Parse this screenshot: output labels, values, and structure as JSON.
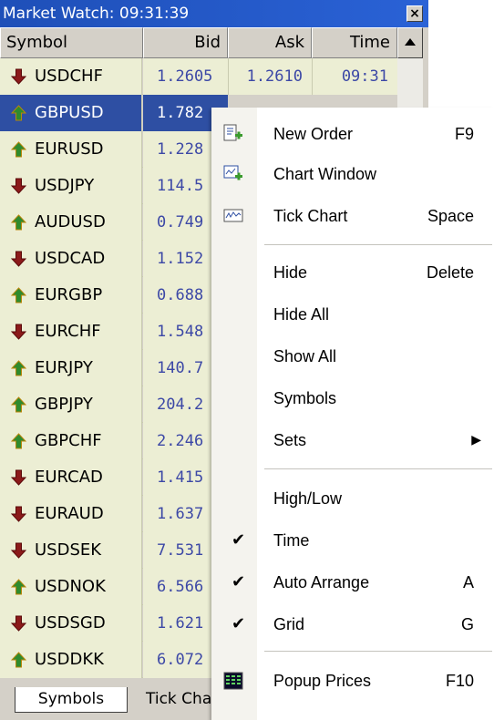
{
  "window": {
    "title": "Market Watch: 09:31:39",
    "close_glyph": "×"
  },
  "columns": {
    "symbol": "Symbol",
    "bid": "Bid",
    "ask": "Ask",
    "time": "Time"
  },
  "rows": [
    {
      "symbol": "USDCHF",
      "bid": "1.2605",
      "ask": "1.2610",
      "time": "09:31",
      "direction": "down"
    },
    {
      "symbol": "GBPUSD",
      "bid": "1.782",
      "direction": "up",
      "selected": true
    },
    {
      "symbol": "EURUSD",
      "bid": "1.228",
      "direction": "up"
    },
    {
      "symbol": "USDJPY",
      "bid": "114.5",
      "direction": "down"
    },
    {
      "symbol": "AUDUSD",
      "bid": "0.749",
      "direction": "up"
    },
    {
      "symbol": "USDCAD",
      "bid": "1.152",
      "direction": "down"
    },
    {
      "symbol": "EURGBP",
      "bid": "0.688",
      "direction": "up"
    },
    {
      "symbol": "EURCHF",
      "bid": "1.548",
      "direction": "down"
    },
    {
      "symbol": "EURJPY",
      "bid": "140.7",
      "direction": "up"
    },
    {
      "symbol": "GBPJPY",
      "bid": "204.2",
      "direction": "up"
    },
    {
      "symbol": "GBPCHF",
      "bid": "2.246",
      "direction": "up"
    },
    {
      "symbol": "EURCAD",
      "bid": "1.415",
      "direction": "down"
    },
    {
      "symbol": "EURAUD",
      "bid": "1.637",
      "direction": "down"
    },
    {
      "symbol": "USDSEK",
      "bid": "7.531",
      "direction": "down"
    },
    {
      "symbol": "USDNOK",
      "bid": "6.566",
      "direction": "up"
    },
    {
      "symbol": "USDSGD",
      "bid": "1.621",
      "direction": "down"
    },
    {
      "symbol": "USDDKK",
      "bid": "6.072",
      "direction": "up"
    }
  ],
  "tabs": {
    "symbols": "Symbols",
    "tick_chart": "Tick Chart"
  },
  "menu": {
    "new_order": {
      "label": "New Order",
      "shortcut": "F9",
      "icon": "new-order-icon"
    },
    "chart_window": {
      "label": "Chart Window",
      "icon": "chart-window-icon"
    },
    "tick_chart": {
      "label": "Tick Chart",
      "shortcut": "Space",
      "icon": "tick-chart-icon"
    },
    "hide": {
      "label": "Hide",
      "shortcut": "Delete"
    },
    "hide_all": {
      "label": "Hide All"
    },
    "show_all": {
      "label": "Show All"
    },
    "symbols": {
      "label": "Symbols"
    },
    "sets": {
      "label": "Sets",
      "submenu_glyph": "▶"
    },
    "high_low": {
      "label": "High/Low",
      "checked": false
    },
    "time": {
      "label": "Time",
      "checked": true
    },
    "auto_arrange": {
      "label": "Auto Arrange",
      "shortcut": "A",
      "checked": true
    },
    "grid": {
      "label": "Grid",
      "shortcut": "G",
      "checked": true
    },
    "popup_prices": {
      "label": "Popup Prices",
      "shortcut": "F10",
      "icon": "popup-prices-icon"
    },
    "check_glyph": "✔"
  },
  "colors": {
    "row_bg": "#eceed4",
    "selected_bg": "#2e4fa3",
    "price_text": "#3c48a6",
    "titlebar": "#1e4fb8"
  }
}
